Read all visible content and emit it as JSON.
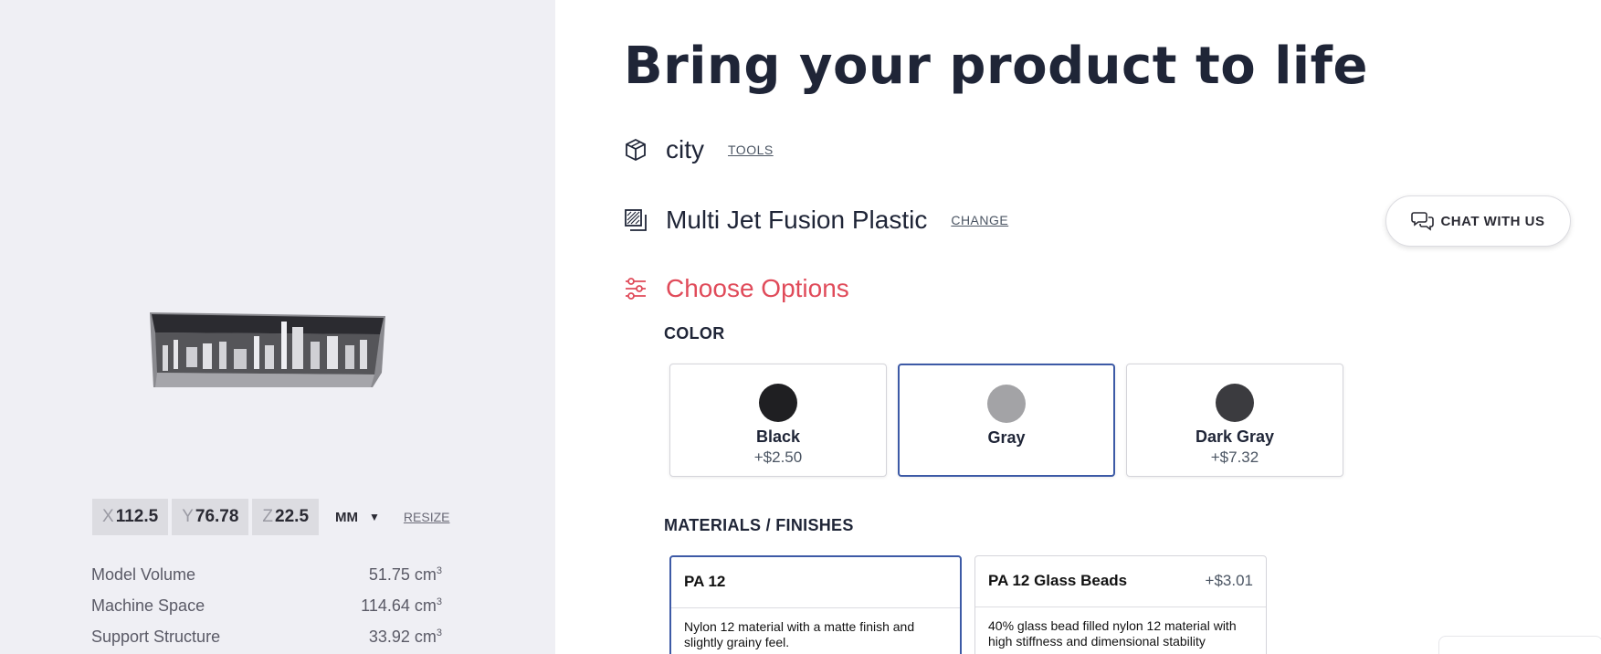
{
  "header": {
    "title": "Bring your product to life"
  },
  "file": {
    "name": "city",
    "tools_label": "TOOLS",
    "icon": "cube-icon"
  },
  "material": {
    "name": "Multi Jet Fusion Plastic",
    "change_label": "CHANGE",
    "icon": "material-texture-icon"
  },
  "options": {
    "title": "Choose Options",
    "icon": "sliders-icon"
  },
  "color_section": {
    "label": "COLOR",
    "items": [
      {
        "name": "Black",
        "price": "+$2.50",
        "swatch": "#1f1f22",
        "selected": false
      },
      {
        "name": "Gray",
        "price": "",
        "swatch": "#a3a3a6",
        "selected": true
      },
      {
        "name": "Dark Gray",
        "price": "+$7.32",
        "swatch": "#3b3b3f",
        "selected": false
      }
    ]
  },
  "materials_section": {
    "label": "MATERIALS / FINISHES",
    "items": [
      {
        "name": "PA 12",
        "price": "",
        "desc": "Nylon 12 material with a matte finish and slightly grainy feel.",
        "selected": true
      },
      {
        "name": "PA 12 Glass Beads",
        "price": "+$3.01",
        "desc": "40% glass bead filled nylon 12 material with high stiffness and dimensional stability",
        "selected": false
      }
    ]
  },
  "dimensions": {
    "x_label": "X",
    "x": "112.5",
    "y_label": "Y",
    "y": "76.78",
    "z_label": "Z",
    "z": "22.5",
    "unit": "MM",
    "resize_label": "RESIZE"
  },
  "stats": [
    {
      "label": "Model Volume",
      "value": "51.75 cm",
      "unit_sup": "3"
    },
    {
      "label": "Machine Space",
      "value": "114.64 cm",
      "unit_sup": "3"
    },
    {
      "label": "Support Structure",
      "value": "33.92 cm",
      "unit_sup": "3"
    }
  ],
  "chat": {
    "label": "CHAT WITH US",
    "icon": "chat-bubbles-icon"
  },
  "colors": {
    "accent": "#3d5aa6",
    "options_title": "#e04b5a",
    "left_bg": "#efeff4",
    "title": "#1f2537"
  }
}
